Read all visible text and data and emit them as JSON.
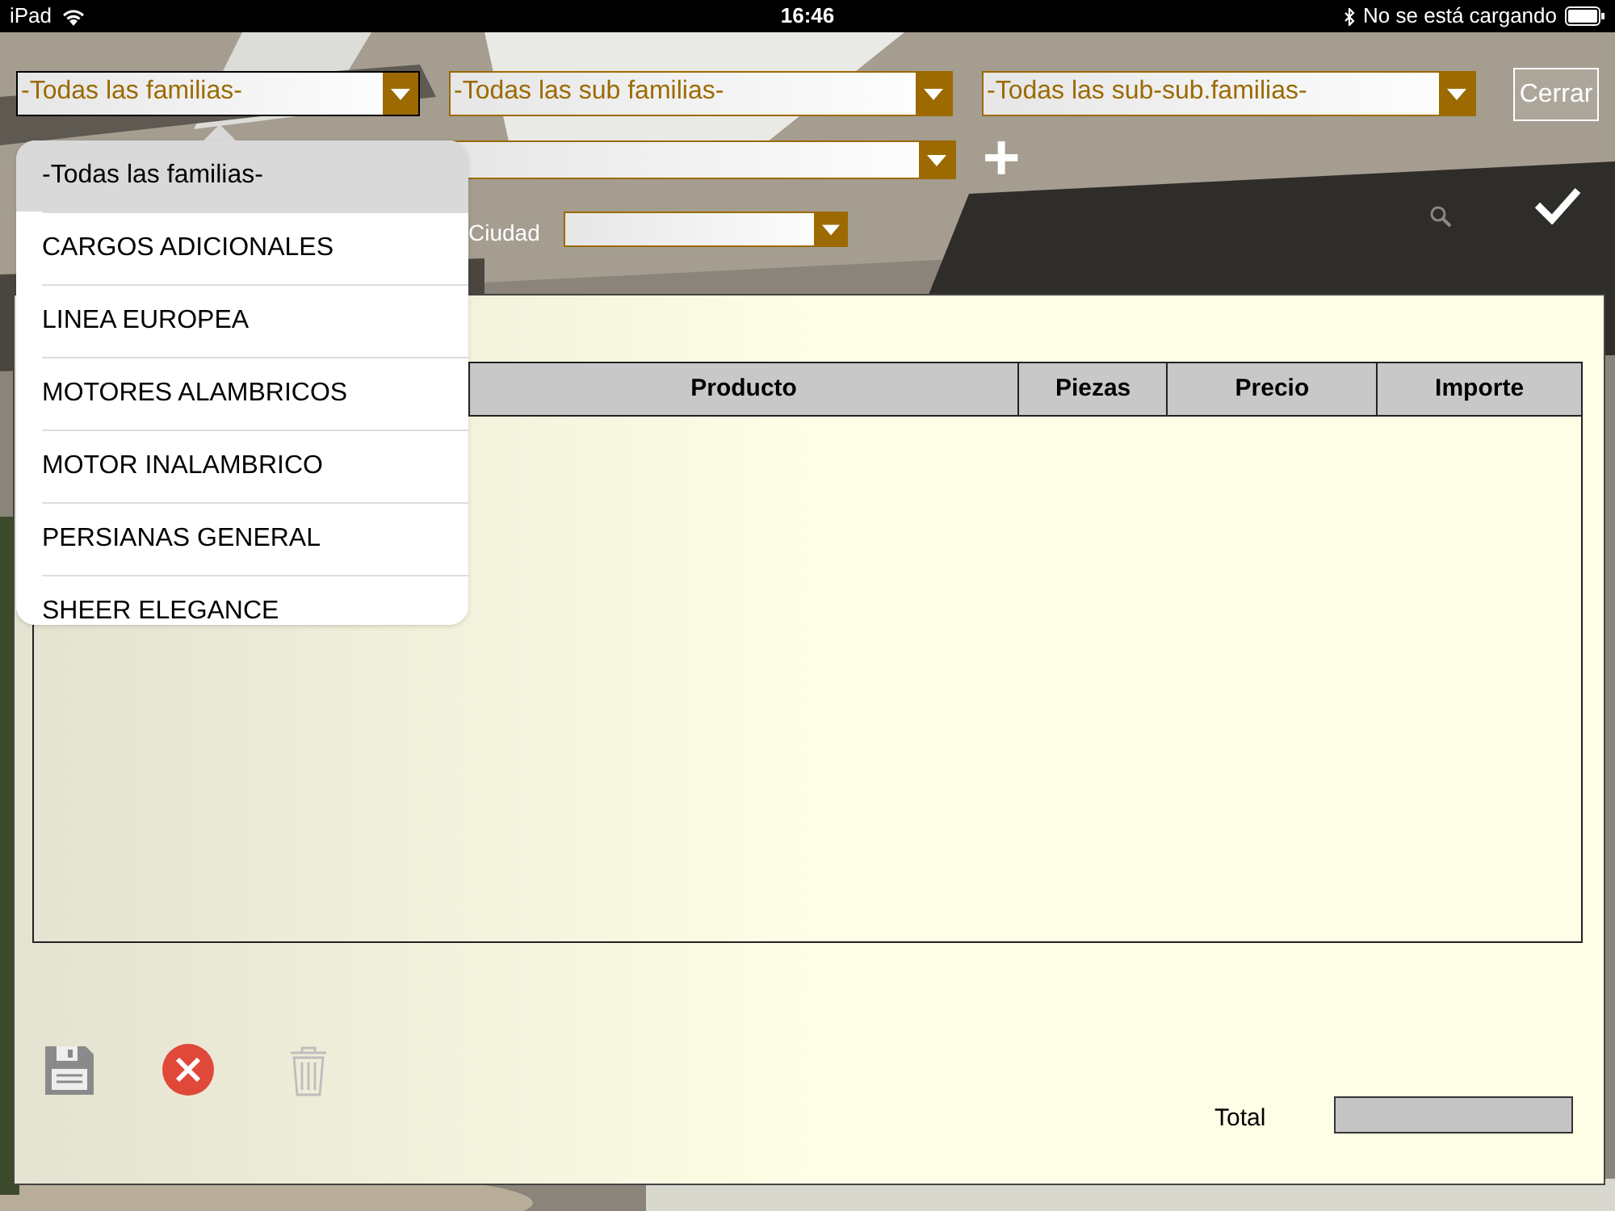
{
  "status_bar": {
    "device": "iPad",
    "time": "16:46",
    "charging_text": "No se está cargando"
  },
  "filters": [
    {
      "value": "-Todas las familias-",
      "open": true
    },
    {
      "value": "-Todas las sub familias-",
      "open": false
    },
    {
      "value": "-Todas las sub-sub.familias-",
      "open": false
    }
  ],
  "close_button": "Cerrar",
  "add_button": "+",
  "city_label": "Ciudad",
  "dropdown": {
    "items": [
      {
        "label": "-Todas las familias-",
        "selected": true
      },
      {
        "label": "CARGOS ADICIONALES",
        "selected": false
      },
      {
        "label": "LINEA EUROPEA",
        "selected": false
      },
      {
        "label": "MOTORES ALAMBRICOS",
        "selected": false
      },
      {
        "label": "MOTOR INALAMBRICO",
        "selected": false
      },
      {
        "label": "PERSIANAS GENERAL",
        "selected": false
      },
      {
        "label": "SHEER ELEGANCE",
        "selected": false
      }
    ]
  },
  "table": {
    "columns": [
      {
        "label": "Producto"
      },
      {
        "label": "Piezas"
      },
      {
        "label": "Precio"
      },
      {
        "label": "Importe"
      }
    ]
  },
  "actions": [
    {
      "kind": "save",
      "disabled": false
    },
    {
      "kind": "cancel",
      "disabled": false
    },
    {
      "kind": "delete",
      "disabled": true
    }
  ],
  "total_label": "Total"
}
